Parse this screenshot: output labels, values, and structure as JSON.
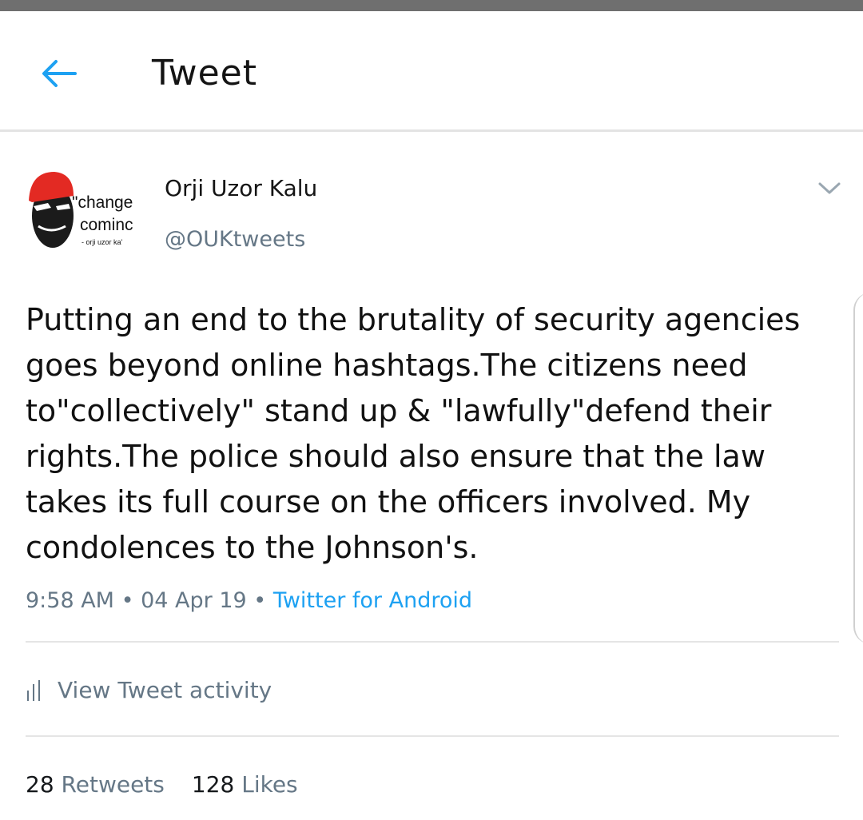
{
  "header": {
    "title": "Tweet",
    "back_icon": "arrow-left-icon",
    "accent_color": "#1da1f2"
  },
  "tweet": {
    "author_name": "Orji Uzor Kalu",
    "author_handle": "@OUKtweets",
    "avatar": {
      "quote_line_1": "\"change",
      "quote_line_2": "cominc",
      "signature": "- orji uzor ka'"
    },
    "more_icon": "chevron-down-icon",
    "text": "Putting an end to the brutality of security agencies\ngoes beyond online hashtags.The citizens need\nto\"collectively\" stand up & \"lawfully\"defend their\nrights.The police should also ensure that the law\ntakes its full course on the officers involved. My\ncondolences to the Johnson's.",
    "time": "9:58 AM",
    "date": "04 Apr 19",
    "separator": "•",
    "source": "Twitter for Android",
    "source_color": "#1da1f2"
  },
  "activity": {
    "icon": "bar-chart-icon",
    "label": "View Tweet activity"
  },
  "stats": {
    "retweets_count": "28",
    "retweets_label": "Retweets",
    "likes_count": "128",
    "likes_label": "Likes"
  }
}
